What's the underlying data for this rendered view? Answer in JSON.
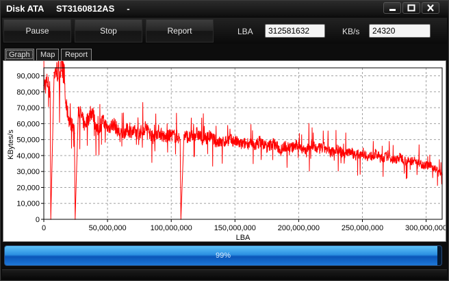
{
  "window": {
    "title": "Disk ATA     ST3160812AS     -"
  },
  "toolbar": {
    "pause_label": "Pause",
    "stop_label": "Stop",
    "report_label": "Report",
    "lba_label": "LBA",
    "lba_value": "312581632",
    "kbs_label": "KB/s",
    "kbs_value": "24320"
  },
  "tabs": [
    {
      "label": "Graph"
    },
    {
      "label": "Map"
    },
    {
      "label": "Report"
    }
  ],
  "progress": {
    "text": "99%",
    "fraction": 0.99
  },
  "colors": {
    "series": "#ff0000",
    "grid": "#a0a0a0",
    "progress": "#2b8fe2"
  },
  "chart_data": {
    "type": "line",
    "xlabel": "LBA",
    "ylabel": "KBytes/s",
    "xlim": [
      0,
      312581632
    ],
    "ylim": [
      0,
      95000
    ],
    "grid": true,
    "x_ticks": [
      0,
      50000000,
      100000000,
      150000000,
      200000000,
      250000000,
      300000000
    ],
    "x_tick_labels": [
      "0",
      "50,000,000",
      "100,000,000",
      "150,000,000",
      "200,000,000",
      "250,000,000",
      "300,000,000"
    ],
    "y_ticks": [
      0,
      10000,
      20000,
      30000,
      40000,
      50000,
      60000,
      70000,
      80000,
      90000
    ],
    "y_tick_labels": [
      "0",
      "10,000",
      "20,000",
      "30,000",
      "40,000",
      "50,000",
      "60,000",
      "70,000",
      "80,000",
      "90,000"
    ],
    "series": [
      {
        "color": "#ff0000",
        "x": [
          0,
          3000000,
          5000000,
          5500000,
          8000000,
          10000000,
          14000000,
          16000000,
          17000000,
          20000000,
          23000000,
          24000000,
          24600000,
          27000000,
          32000000,
          38000000,
          42000000,
          46000000,
          50000000,
          55000000,
          60000000,
          65000000,
          70000000,
          75000000,
          80000000,
          85000000,
          90000000,
          95000000,
          100000000,
          105000000,
          107000000,
          107600000,
          110000000,
          115000000,
          120000000,
          125000000,
          130000000,
          135000000,
          140000000,
          145000000,
          150000000,
          155000000,
          160000000,
          165000000,
          170000000,
          175000000,
          180000000,
          185000000,
          190000000,
          195000000,
          200000000,
          205000000,
          210000000,
          215000000,
          220000000,
          225000000,
          230000000,
          235000000,
          240000000,
          245000000,
          250000000,
          255000000,
          260000000,
          265000000,
          270000000,
          275000000,
          280000000,
          285000000,
          290000000,
          295000000,
          300000000,
          305000000,
          310000000,
          312581632
        ],
        "y": [
          84000,
          86000,
          80000,
          0,
          92000,
          93000,
          93000,
          92000,
          73000,
          62000,
          58000,
          54000,
          0,
          70000,
          59000,
          68000,
          55000,
          62000,
          57000,
          60000,
          53000,
          56000,
          55000,
          54000,
          58000,
          52000,
          55000,
          51000,
          53000,
          52000,
          50000,
          0,
          53000,
          51000,
          54000,
          50000,
          52000,
          49000,
          48000,
          50000,
          49000,
          47000,
          48000,
          46000,
          49000,
          45000,
          48000,
          44000,
          46000,
          45000,
          47000,
          43000,
          46000,
          44000,
          45000,
          42000,
          44000,
          41000,
          43000,
          40000,
          42000,
          39000,
          41000,
          38000,
          40000,
          37000,
          39000,
          36000,
          37000,
          35000,
          34000,
          33000,
          30000,
          28000
        ]
      }
    ]
  }
}
